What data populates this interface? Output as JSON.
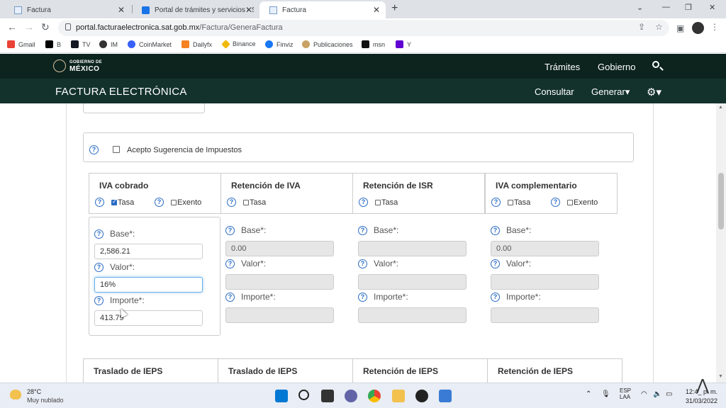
{
  "browser": {
    "tabs": [
      {
        "label": "Factura"
      },
      {
        "label": "Portal de trámites y servicios - SA"
      },
      {
        "label": "Factura"
      }
    ],
    "url_domain": "portal.facturaelectronica.sat.gob.mx",
    "url_path": "/Factura/GeneraFactura",
    "bookmarks": [
      {
        "label": "Gmail",
        "color": "#ea4335"
      },
      {
        "label": "B",
        "color": "#000000"
      },
      {
        "label": "TV",
        "color": "#131722"
      },
      {
        "label": "IM",
        "color": "#333333"
      },
      {
        "label": "CoinMarket",
        "color": "#3861fb"
      },
      {
        "label": "Dailyfx",
        "color": "#f58220"
      },
      {
        "label": "Binance",
        "color": "#f0b90b"
      },
      {
        "label": "Finviz",
        "color": "#1877f2"
      },
      {
        "label": "Publicaciones",
        "color": "#c8a165"
      },
      {
        "label": "msn",
        "color": "#111111"
      },
      {
        "label": "Y",
        "color": "#6001d2"
      }
    ]
  },
  "gob_header": {
    "logo_small": "GOBIERNO DE",
    "logo_big": "MÉXICO",
    "nav": [
      "Trámites",
      "Gobierno"
    ]
  },
  "app_header": {
    "title": "FACTURA ELECTRÓNICA",
    "consultar": "Consultar",
    "generar": "Generar▾"
  },
  "form": {
    "suggestion_label": "Acepto Sugerencia de Impuestos",
    "tax_columns": [
      {
        "title": "IVA cobrado",
        "opt1": "Tasa",
        "opt2": "Exento"
      },
      {
        "title": "Retención de IVA",
        "opt1": "Tasa"
      },
      {
        "title": "Retención de ISR",
        "opt1": "Tasa"
      },
      {
        "title": "IVA complementario",
        "opt1": "Tasa",
        "opt2": "Exento"
      }
    ],
    "labels": {
      "base": "Base*:",
      "valor": "Valor*:",
      "importe": "Importe*:"
    },
    "iva_cobrado": {
      "base": "2,586.21",
      "valor": "16%",
      "importe": "413.79"
    },
    "ret_iva": {
      "base": "0.00",
      "valor": "",
      "importe": ""
    },
    "ret_isr": {
      "base": "",
      "valor": "",
      "importe": ""
    },
    "iva_comp": {
      "base": "0.00",
      "valor": "",
      "importe": ""
    },
    "ieps_columns": [
      "Traslado de IEPS",
      "Traslado de IEPS",
      "Retención de IEPS",
      "Retención de IEPS"
    ]
  },
  "taskbar": {
    "temp": "28°C",
    "weather": "Muy nublado",
    "lang1": "ESP",
    "lang2": "LAA",
    "time": "12:4_ p. m.",
    "date": "31/03/2022"
  }
}
